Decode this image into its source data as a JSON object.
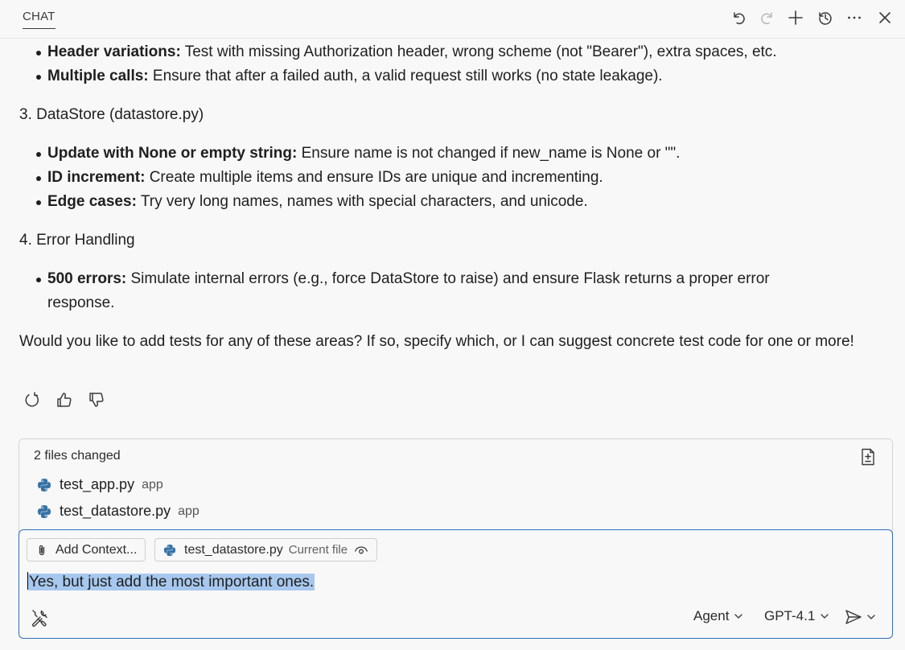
{
  "header": {
    "tab_label": "CHAT",
    "icons": [
      "undo-icon",
      "redo-icon",
      "new-chat-icon",
      "history-icon",
      "more-icon",
      "close-icon"
    ]
  },
  "message": {
    "auth_bullets": [
      {
        "bold": "Header variations:",
        "text": " Test with missing Authorization header, wrong scheme (not \"Bearer\"), extra spaces, etc."
      },
      {
        "bold": "Multiple calls:",
        "text": " Ensure that after a failed auth, a valid request still works (no state leakage)."
      }
    ],
    "section3_title": "3. DataStore (datastore.py)",
    "datastore_bullets": [
      {
        "bold": "Update with None or empty string:",
        "text": " Ensure name is not changed if new_name is None or \"\"."
      },
      {
        "bold": "ID increment:",
        "text": " Create multiple items and ensure IDs are unique and incrementing."
      },
      {
        "bold": "Edge cases:",
        "text": " Try very long names, names with special characters, and unicode."
      }
    ],
    "section4_title": "4. Error Handling",
    "error_bullets": [
      {
        "bold": "500 errors:",
        "text": " Simulate internal errors (e.g., force DataStore to raise) and ensure Flask returns a proper error response."
      }
    ],
    "closing": "Would you like to add tests for any of these areas? If so, specify which, or I can suggest concrete test code for one or more!"
  },
  "feedback": {
    "icons": [
      "retry-icon",
      "thumbs-up-icon",
      "thumbs-down-icon"
    ]
  },
  "files_changed": {
    "title": "2 files changed",
    "files": [
      {
        "name": "test_app.py",
        "dir": "app"
      },
      {
        "name": "test_datastore.py",
        "dir": "app"
      }
    ]
  },
  "input": {
    "add_context_label": "Add Context...",
    "current_file_name": "test_datastore.py",
    "current_file_tag": "Current file",
    "value": "Yes, but just add the most important ones.",
    "mode": "Agent",
    "model": "GPT-4.1"
  },
  "colors": {
    "accent": "#2f6fbe",
    "selection": "#a7c8ee",
    "python_blue": "#3572a5",
    "background": "#f8f8f8"
  }
}
